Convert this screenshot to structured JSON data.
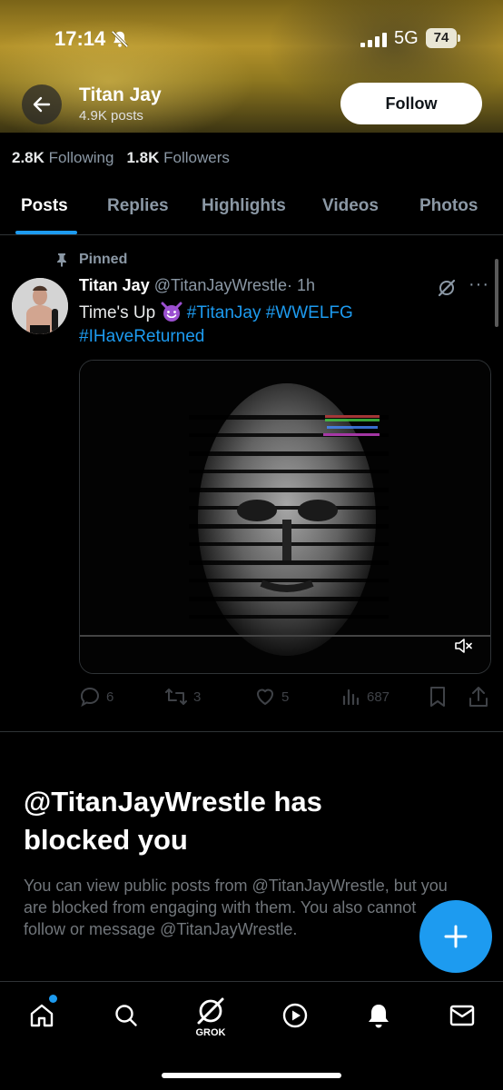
{
  "status_bar": {
    "time": "17:14",
    "network": "5G",
    "battery": "74"
  },
  "header": {
    "name": "Titan Jay",
    "posts": "4.9K posts",
    "follow_label": "Follow"
  },
  "stats": {
    "following_count": "2.8K",
    "following_label": "Following",
    "followers_count": "1.8K",
    "followers_label": "Followers"
  },
  "tabs": [
    {
      "label": "Posts",
      "active": true
    },
    {
      "label": "Replies"
    },
    {
      "label": "Highlights"
    },
    {
      "label": "Videos"
    },
    {
      "label": "Photos"
    }
  ],
  "post": {
    "pinned_label": "Pinned",
    "author_name": "Titan Jay",
    "handle": "@TitanJayWrestle",
    "time": "· 1h",
    "text_plain": "Time's Up",
    "hashtags": [
      "#TitanJay",
      "#WWELFG",
      "#IHaveReturned"
    ],
    "replies": "6",
    "reposts": "3",
    "likes": "5",
    "views": "687"
  },
  "blocked": {
    "title": "@TitanJayWrestle has blocked you",
    "description": "You can view public posts from @TitanJayWrestle, but you are blocked from engaging with them. You also cannot follow or message @TitanJayWrestle."
  },
  "bottom_nav": {
    "grok_label": "GROK"
  },
  "colors": {
    "accent": "#1d9bf0",
    "background": "#000000",
    "muted": "#8b98a5"
  }
}
